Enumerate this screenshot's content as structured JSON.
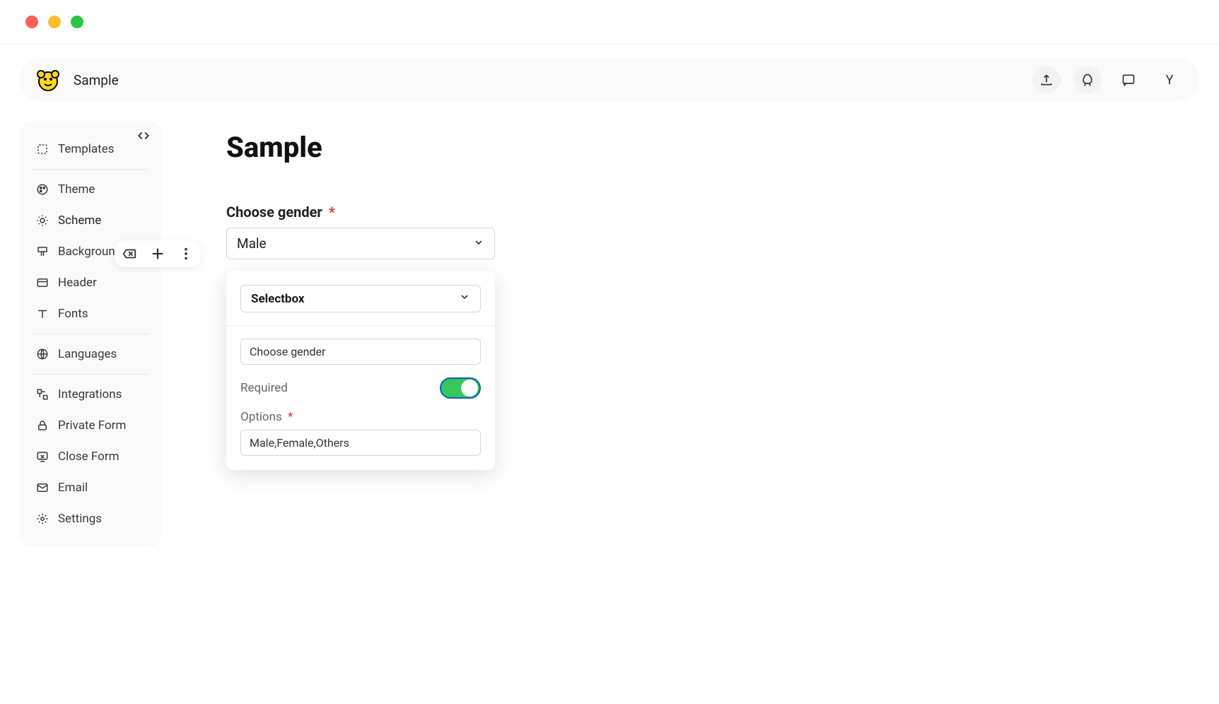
{
  "header": {
    "title": "Sample",
    "avatar_letter": "Y"
  },
  "sidebar": {
    "items": [
      {
        "label": "Templates"
      },
      {
        "label": "Theme"
      },
      {
        "label": "Scheme"
      },
      {
        "label": "Background"
      },
      {
        "label": "Header"
      },
      {
        "label": "Fonts"
      },
      {
        "label": "Languages"
      },
      {
        "label": "Integrations"
      },
      {
        "label": "Private Form"
      },
      {
        "label": "Close Form"
      },
      {
        "label": "Email"
      },
      {
        "label": "Settings"
      }
    ]
  },
  "main": {
    "page_title": "Sample",
    "field": {
      "label": "Choose gender",
      "required_marker": "*",
      "selected_value": "Male"
    },
    "config": {
      "type_label": "Selectbox",
      "name_value": "Choose gender",
      "required_label": "Required",
      "required_on": true,
      "options_label": "Options",
      "options_required_marker": "*",
      "options_value": "Male,Female,Others"
    }
  }
}
